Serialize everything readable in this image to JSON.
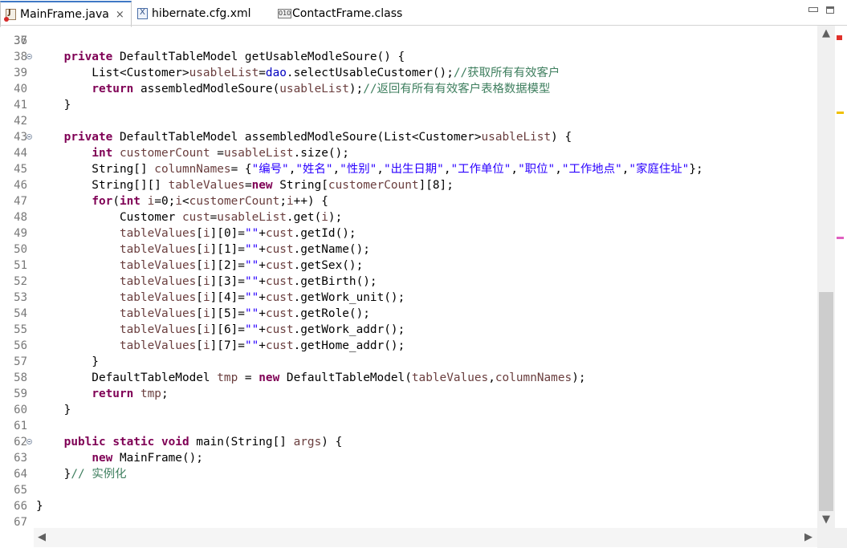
{
  "tabs": [
    {
      "label": "MainFrame.java",
      "icon": "java-file-icon",
      "active": true,
      "close": "×"
    },
    {
      "label": "hibernate.cfg.xml",
      "icon": "xml-file-icon",
      "active": false
    },
    {
      "label": "ContactFrame.class",
      "icon": "class-file-icon",
      "active": false
    }
  ],
  "editor": {
    "first_partial_line": "36",
    "lines": [
      {
        "n": "37",
        "fold": false,
        "tokens": []
      },
      {
        "n": "38",
        "fold": true,
        "tokens": [
          [
            "    ",
            ""
          ],
          [
            "private",
            "kw"
          ],
          [
            " DefaultTableModel getUsableModleSoure() {",
            ""
          ]
        ]
      },
      {
        "n": "39",
        "fold": false,
        "tokens": [
          [
            "        List<Customer>",
            ""
          ],
          [
            "usableList",
            "lv"
          ],
          [
            "=",
            ""
          ],
          [
            "dao",
            "fd"
          ],
          [
            ".selectUsableCustomer();",
            ""
          ],
          [
            "//获取所有有效客户",
            "cmt"
          ]
        ]
      },
      {
        "n": "40",
        "fold": false,
        "tokens": [
          [
            "        ",
            ""
          ],
          [
            "return",
            "kw"
          ],
          [
            " assembledModleSoure(",
            ""
          ],
          [
            "usableList",
            "lv"
          ],
          [
            ");",
            ""
          ],
          [
            "//返回有所有有效客户表格数据模型",
            "cmt"
          ]
        ]
      },
      {
        "n": "41",
        "fold": false,
        "tokens": [
          [
            "    }",
            ""
          ]
        ]
      },
      {
        "n": "42",
        "fold": false,
        "tokens": []
      },
      {
        "n": "43",
        "fold": true,
        "tokens": [
          [
            "    ",
            ""
          ],
          [
            "private",
            "kw"
          ],
          [
            " DefaultTableModel assembledModleSoure(List<Customer>",
            ""
          ],
          [
            "usableList",
            "lv"
          ],
          [
            ") {",
            ""
          ]
        ]
      },
      {
        "n": "44",
        "fold": false,
        "tokens": [
          [
            "        ",
            ""
          ],
          [
            "int",
            "kw"
          ],
          [
            " ",
            ""
          ],
          [
            "customerCount",
            "lv"
          ],
          [
            " =",
            ""
          ],
          [
            "usableList",
            "lv"
          ],
          [
            ".size();",
            ""
          ]
        ]
      },
      {
        "n": "45",
        "fold": false,
        "tokens": [
          [
            "        String[] ",
            ""
          ],
          [
            "columnNames",
            "lv"
          ],
          [
            "= {",
            ""
          ],
          [
            "\"编号\"",
            "str"
          ],
          [
            ",",
            ""
          ],
          [
            "\"姓名\"",
            "str"
          ],
          [
            ",",
            ""
          ],
          [
            "\"性别\"",
            "str"
          ],
          [
            ",",
            ""
          ],
          [
            "\"出生日期\"",
            "str"
          ],
          [
            ",",
            ""
          ],
          [
            "\"工作单位\"",
            "str"
          ],
          [
            ",",
            ""
          ],
          [
            "\"职位\"",
            "str"
          ],
          [
            ",",
            ""
          ],
          [
            "\"工作地点\"",
            "str"
          ],
          [
            ",",
            ""
          ],
          [
            "\"家庭住址\"",
            "str"
          ],
          [
            "};",
            ""
          ]
        ]
      },
      {
        "n": "46",
        "fold": false,
        "tokens": [
          [
            "        String[][] ",
            ""
          ],
          [
            "tableValues",
            "lv"
          ],
          [
            "=",
            ""
          ],
          [
            "new",
            "kw"
          ],
          [
            " String[",
            ""
          ],
          [
            "customerCount",
            "lv"
          ],
          [
            "][8];",
            ""
          ]
        ]
      },
      {
        "n": "47",
        "fold": false,
        "tokens": [
          [
            "        ",
            ""
          ],
          [
            "for",
            "kw"
          ],
          [
            "(",
            ""
          ],
          [
            "int",
            "kw"
          ],
          [
            " ",
            ""
          ],
          [
            "i",
            "lv"
          ],
          [
            "=0;",
            ""
          ],
          [
            "i",
            "lv"
          ],
          [
            "<",
            ""
          ],
          [
            "customerCount",
            "lv"
          ],
          [
            ";",
            ""
          ],
          [
            "i",
            "lv"
          ],
          [
            "++) {",
            ""
          ]
        ]
      },
      {
        "n": "48",
        "fold": false,
        "tokens": [
          [
            "            Customer ",
            ""
          ],
          [
            "cust",
            "lv"
          ],
          [
            "=",
            ""
          ],
          [
            "usableList",
            "lv"
          ],
          [
            ".get(",
            ""
          ],
          [
            "i",
            "lv"
          ],
          [
            ");",
            ""
          ]
        ]
      },
      {
        "n": "49",
        "fold": false,
        "tokens": [
          [
            "            ",
            ""
          ],
          [
            "tableValues",
            "lv"
          ],
          [
            "[",
            ""
          ],
          [
            "i",
            "lv"
          ],
          [
            "][0]=",
            ""
          ],
          [
            "\"\"",
            "str"
          ],
          [
            "+",
            ""
          ],
          [
            "cust",
            "lv"
          ],
          [
            ".getId();",
            ""
          ]
        ]
      },
      {
        "n": "50",
        "fold": false,
        "tokens": [
          [
            "            ",
            ""
          ],
          [
            "tableValues",
            "lv"
          ],
          [
            "[",
            ""
          ],
          [
            "i",
            "lv"
          ],
          [
            "][1]=",
            ""
          ],
          [
            "\"\"",
            "str"
          ],
          [
            "+",
            ""
          ],
          [
            "cust",
            "lv"
          ],
          [
            ".getName();",
            ""
          ]
        ]
      },
      {
        "n": "51",
        "fold": false,
        "tokens": [
          [
            "            ",
            ""
          ],
          [
            "tableValues",
            "lv"
          ],
          [
            "[",
            ""
          ],
          [
            "i",
            "lv"
          ],
          [
            "][2]=",
            ""
          ],
          [
            "\"\"",
            "str"
          ],
          [
            "+",
            ""
          ],
          [
            "cust",
            "lv"
          ],
          [
            ".getSex();",
            ""
          ]
        ]
      },
      {
        "n": "52",
        "fold": false,
        "tokens": [
          [
            "            ",
            ""
          ],
          [
            "tableValues",
            "lv"
          ],
          [
            "[",
            ""
          ],
          [
            "i",
            "lv"
          ],
          [
            "][3]=",
            ""
          ],
          [
            "\"\"",
            "str"
          ],
          [
            "+",
            ""
          ],
          [
            "cust",
            "lv"
          ],
          [
            ".getBirth();",
            ""
          ]
        ]
      },
      {
        "n": "53",
        "fold": false,
        "tokens": [
          [
            "            ",
            ""
          ],
          [
            "tableValues",
            "lv"
          ],
          [
            "[",
            ""
          ],
          [
            "i",
            "lv"
          ],
          [
            "][4]=",
            ""
          ],
          [
            "\"\"",
            "str"
          ],
          [
            "+",
            ""
          ],
          [
            "cust",
            "lv"
          ],
          [
            ".getWork_unit();",
            ""
          ]
        ]
      },
      {
        "n": "54",
        "fold": false,
        "tokens": [
          [
            "            ",
            ""
          ],
          [
            "tableValues",
            "lv"
          ],
          [
            "[",
            ""
          ],
          [
            "i",
            "lv"
          ],
          [
            "][5]=",
            ""
          ],
          [
            "\"\"",
            "str"
          ],
          [
            "+",
            ""
          ],
          [
            "cust",
            "lv"
          ],
          [
            ".getRole();",
            ""
          ]
        ]
      },
      {
        "n": "55",
        "fold": false,
        "tokens": [
          [
            "            ",
            ""
          ],
          [
            "tableValues",
            "lv"
          ],
          [
            "[",
            ""
          ],
          [
            "i",
            "lv"
          ],
          [
            "][6]=",
            ""
          ],
          [
            "\"\"",
            "str"
          ],
          [
            "+",
            ""
          ],
          [
            "cust",
            "lv"
          ],
          [
            ".getWork_addr();",
            ""
          ]
        ]
      },
      {
        "n": "56",
        "fold": false,
        "tokens": [
          [
            "            ",
            ""
          ],
          [
            "tableValues",
            "lv"
          ],
          [
            "[",
            ""
          ],
          [
            "i",
            "lv"
          ],
          [
            "][7]=",
            ""
          ],
          [
            "\"\"",
            "str"
          ],
          [
            "+",
            ""
          ],
          [
            "cust",
            "lv"
          ],
          [
            ".getHome_addr();",
            ""
          ]
        ]
      },
      {
        "n": "57",
        "fold": false,
        "tokens": [
          [
            "        }",
            ""
          ]
        ]
      },
      {
        "n": "58",
        "fold": false,
        "tokens": [
          [
            "        DefaultTableModel ",
            ""
          ],
          [
            "tmp",
            "lv"
          ],
          [
            " = ",
            ""
          ],
          [
            "new",
            "kw"
          ],
          [
            " DefaultTableModel(",
            ""
          ],
          [
            "tableValues",
            "lv"
          ],
          [
            ",",
            ""
          ],
          [
            "columnNames",
            "lv"
          ],
          [
            ");",
            ""
          ]
        ]
      },
      {
        "n": "59",
        "fold": false,
        "tokens": [
          [
            "        ",
            ""
          ],
          [
            "return",
            "kw"
          ],
          [
            " ",
            ""
          ],
          [
            "tmp",
            "lv"
          ],
          [
            ";",
            ""
          ]
        ]
      },
      {
        "n": "60",
        "fold": false,
        "tokens": [
          [
            "    }",
            ""
          ]
        ]
      },
      {
        "n": "61",
        "fold": false,
        "tokens": []
      },
      {
        "n": "62",
        "fold": true,
        "tokens": [
          [
            "    ",
            ""
          ],
          [
            "public",
            "kw"
          ],
          [
            " ",
            ""
          ],
          [
            "static",
            "kw"
          ],
          [
            " ",
            ""
          ],
          [
            "void",
            "kw"
          ],
          [
            " main(String[] ",
            ""
          ],
          [
            "args",
            "lv"
          ],
          [
            ") {",
            ""
          ]
        ]
      },
      {
        "n": "63",
        "fold": false,
        "tokens": [
          [
            "        ",
            ""
          ],
          [
            "new",
            "kw"
          ],
          [
            " MainFrame();",
            ""
          ]
        ]
      },
      {
        "n": "64",
        "fold": false,
        "tokens": [
          [
            "    }",
            ""
          ],
          [
            "// 实例化",
            "cmt"
          ]
        ]
      },
      {
        "n": "65",
        "fold": false,
        "tokens": []
      },
      {
        "n": "66",
        "fold": false,
        "tokens": [
          [
            "}",
            ""
          ]
        ]
      },
      {
        "n": "67",
        "fold": false,
        "tokens": []
      }
    ]
  },
  "scrollbar": {
    "up_arrow": "▲",
    "down_arrow": "▼",
    "left_arrow": "◀",
    "right_arrow": "▶"
  },
  "colors": {
    "keyword": "#7f0055",
    "field": "#0000c0",
    "local_var": "#6a3e3e",
    "string": "#2a00ff",
    "comment": "#3f7f5f",
    "tab_accent": "#3f78c5",
    "warning_mark": "#f0c000",
    "search_mark": "#e060c0"
  }
}
